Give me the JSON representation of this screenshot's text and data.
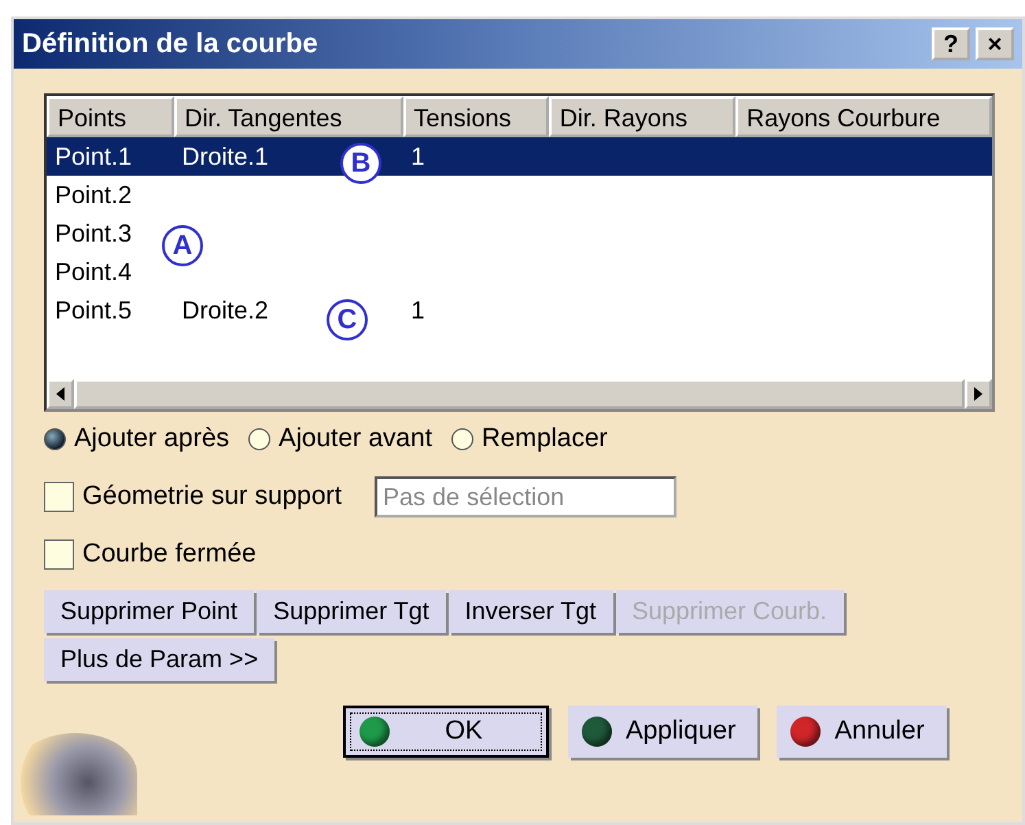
{
  "window": {
    "title": "Définition de la courbe",
    "title_buttons": [
      "?",
      "×"
    ]
  },
  "table": {
    "columns": [
      "Points",
      "Dir. Tangentes",
      "Tensions",
      "Dir. Rayons",
      "Rayons Courbure"
    ],
    "rows": [
      {
        "cells": [
          "Point.1",
          "Droite.1",
          "1",
          "",
          ""
        ],
        "selected": true
      },
      {
        "cells": [
          "Point.2",
          "",
          "",
          "",
          ""
        ],
        "selected": false
      },
      {
        "cells": [
          "Point.3",
          "",
          "",
          "",
          ""
        ],
        "selected": false
      },
      {
        "cells": [
          "Point.4",
          "",
          "",
          "",
          ""
        ],
        "selected": false
      },
      {
        "cells": [
          "Point.5",
          "Droite.2",
          "1",
          "",
          ""
        ],
        "selected": false
      }
    ]
  },
  "callouts": [
    {
      "label": "B"
    },
    {
      "label": "A"
    },
    {
      "label": "C"
    }
  ],
  "radios": [
    {
      "label": "Ajouter après",
      "selected": true
    },
    {
      "label": "Ajouter avant",
      "selected": false
    },
    {
      "label": "Remplacer",
      "selected": false
    }
  ],
  "support": {
    "label": "Géometrie sur support",
    "checked": false,
    "placeholder": "Pas de sélection"
  },
  "closed_curve": {
    "label": "Courbe fermée",
    "checked": false
  },
  "action_buttons": [
    {
      "label": "Supprimer Point",
      "disabled": false
    },
    {
      "label": "Supprimer Tgt",
      "disabled": false
    },
    {
      "label": "Inverser Tgt",
      "disabled": false
    },
    {
      "label": "Supprimer Courb.",
      "disabled": true
    }
  ],
  "more_button": "Plus de Param >>",
  "dialog_buttons": [
    {
      "label": "OK",
      "color": "#1f9a4a",
      "default": true
    },
    {
      "label": "Appliquer",
      "color": "#1f5a3a",
      "default": false
    },
    {
      "label": "Annuler",
      "color": "#d0262a",
      "default": false
    }
  ]
}
